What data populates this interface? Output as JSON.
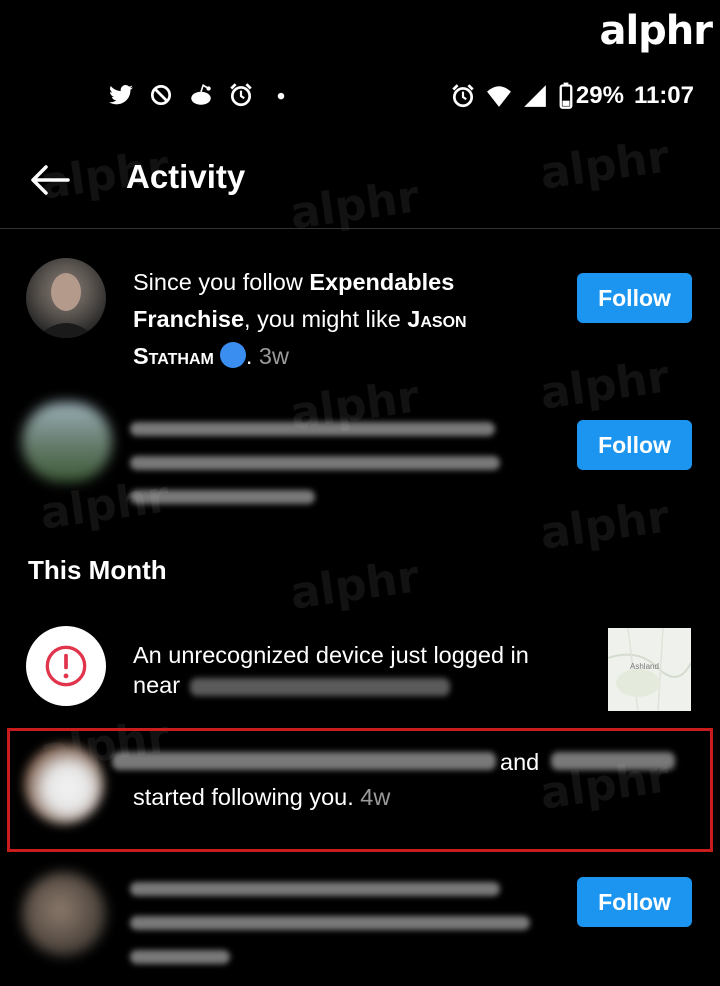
{
  "watermark": "alphr",
  "status_bar": {
    "left_icons": [
      "twitter-icon",
      "tinder-icon",
      "reddit-icon",
      "alarm-icon",
      "dot-icon"
    ],
    "right_icons": [
      "alarm-icon",
      "wifi-icon",
      "signal-icon",
      "battery-icon"
    ],
    "battery": "29%",
    "time": "11:07"
  },
  "header": {
    "title": "Activity"
  },
  "suggestions": [
    {
      "text_pre": "Since you follow ",
      "bold_1": "Expendables Franchise",
      "text_mid": ", you might like ",
      "bold_2": "Jason Statham",
      "text_post": ". ",
      "time": "3w",
      "button": "Follow"
    },
    {
      "button": "Follow"
    }
  ],
  "section_title": "This Month",
  "alert": {
    "text": "An unrecognized device just logged in near",
    "map_label": "Ashland"
  },
  "follow_notice": {
    "and": "and",
    "text": "started following you.",
    "time": "4w"
  },
  "last_row": {
    "button": "Follow"
  },
  "colors": {
    "accent": "#1b95f0",
    "highlight": "#c91d1d",
    "background": "#000000"
  }
}
